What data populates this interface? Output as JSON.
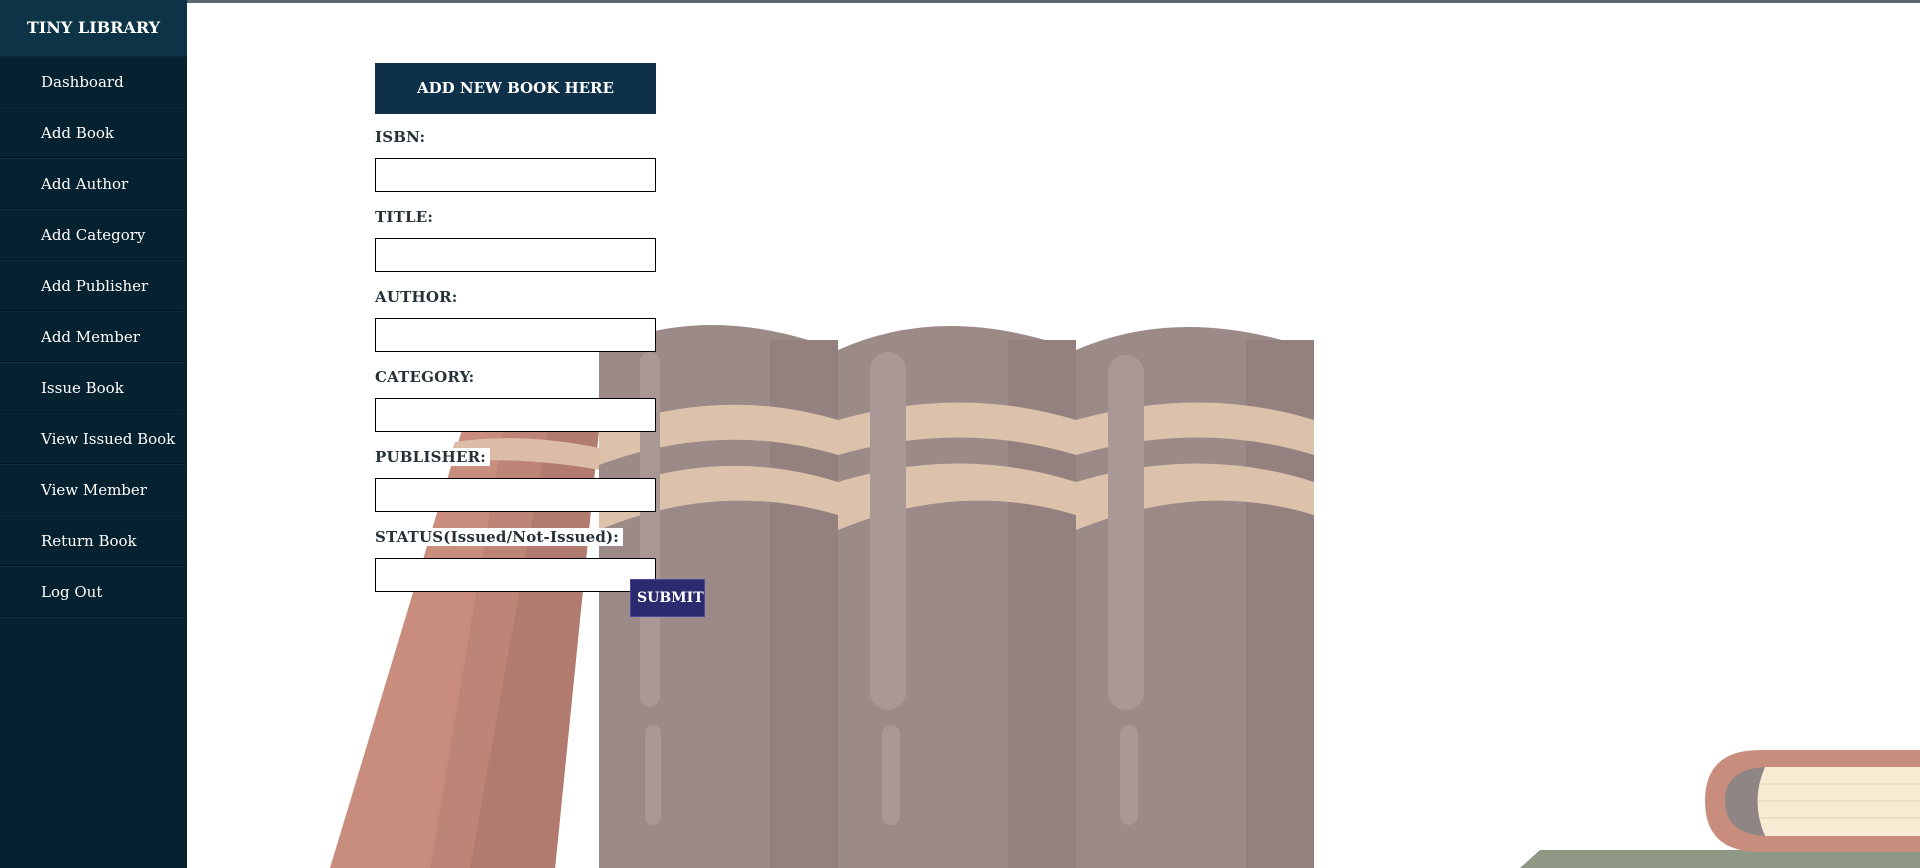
{
  "app": {
    "brand": "TINY LIBRARY"
  },
  "sidebar": {
    "items": [
      {
        "label": "Dashboard"
      },
      {
        "label": "Add Book"
      },
      {
        "label": "Add Author"
      },
      {
        "label": "Add Category"
      },
      {
        "label": "Add Publisher"
      },
      {
        "label": "Add Member"
      },
      {
        "label": "Issue Book"
      },
      {
        "label": "View Issued Book"
      },
      {
        "label": "View Member"
      },
      {
        "label": "Return Book"
      },
      {
        "label": "Log Out"
      }
    ]
  },
  "form": {
    "title": "ADD NEW BOOK HERE",
    "fields": [
      {
        "label": "ISBN:",
        "value": ""
      },
      {
        "label": "TITLE:",
        "value": ""
      },
      {
        "label": "AUTHOR:",
        "value": ""
      },
      {
        "label": "CATEGORY:",
        "value": ""
      },
      {
        "label": "PUBLISHER:",
        "value": ""
      },
      {
        "label": "STATUS(Issued/Not-Issued):",
        "value": ""
      }
    ],
    "submit_label": "SUBMIT"
  },
  "colors": {
    "sidebar_bg": "#06212f",
    "header_bg": "#0f3049",
    "submit_bg": "#2b2a6f",
    "book_spine": "#9a8784",
    "book_band": "#d8bfaa",
    "book_leaning": "#c68f7f"
  }
}
